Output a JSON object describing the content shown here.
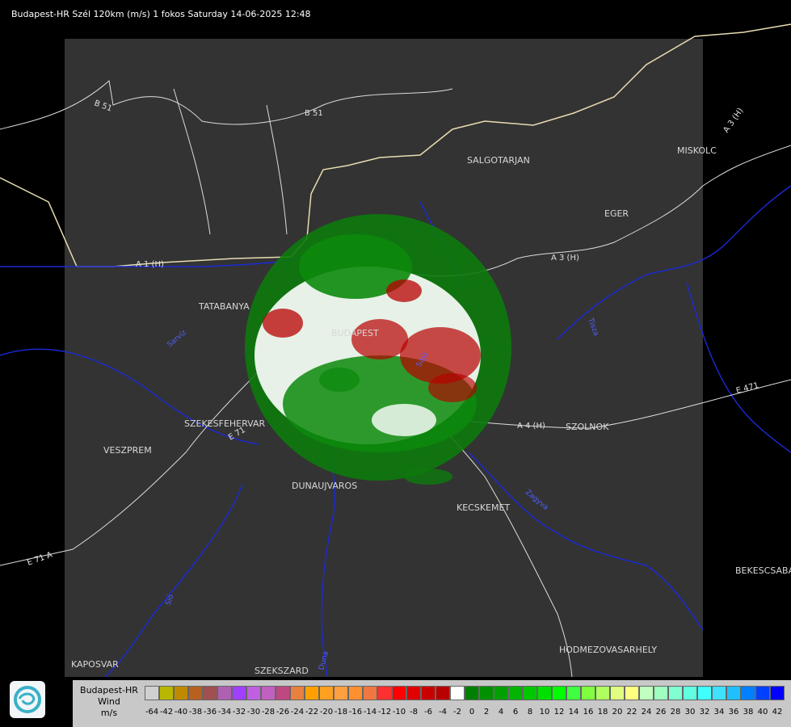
{
  "title": "Budapest-HR Szél 120km (m/s) 1 fokos Saturday 14-06-2025 12:48",
  "cities": [
    {
      "name": "SALGOTARJAN"
    },
    {
      "name": "MISKOLC"
    },
    {
      "name": "EGER"
    },
    {
      "name": "TATABANYA"
    },
    {
      "name": "BUDAPEST"
    },
    {
      "name": "SZEKESFEHERVAR"
    },
    {
      "name": "VESZPREM"
    },
    {
      "name": "DUNAUJVAROS"
    },
    {
      "name": "KECSKEMET"
    },
    {
      "name": "SZOLNOK"
    },
    {
      "name": "BEKESCSABA"
    },
    {
      "name": "HODMEZOVASARHELY"
    },
    {
      "name": "KAPOSVAR"
    },
    {
      "name": "SZEKSZARD"
    }
  ],
  "roads": [
    "B 51",
    "B 51",
    "A 1 (H)",
    "A 3 (H)",
    "A 3 (H)",
    "E 71",
    "A 4 (H)",
    "E 471",
    "E 71 A"
  ],
  "rivers": [
    "Tisza",
    "Duna",
    "Sarvíz",
    "Sió",
    "Zagyva",
    "Sajó"
  ],
  "legend": {
    "site": "Budapest-HR",
    "quantity": "Wind",
    "unit": "m/s",
    "ticks": [
      "-64",
      "-42",
      "-40",
      "-38",
      "-36",
      "-34",
      "-32",
      "-30",
      "-28",
      "-26",
      "-24",
      "-22",
      "-20",
      "-18",
      "-16",
      "-14",
      "-12",
      "-10",
      "-8",
      "-6",
      "-4",
      "-2",
      "0",
      "2",
      "4",
      "6",
      "8",
      "10",
      "12",
      "14",
      "16",
      "18",
      "20",
      "22",
      "24",
      "26",
      "28",
      "30",
      "32",
      "34",
      "36",
      "38",
      "40",
      "42"
    ],
    "colors": [
      "#d0d0d0",
      "#b8b800",
      "#c08a00",
      "#b86020",
      "#a05050",
      "#b060b0",
      "#a040ff",
      "#c060e0",
      "#c060c0",
      "#c04880",
      "#e88040",
      "#ffa000",
      "#ffa020",
      "#ffa040",
      "#ff9030",
      "#f07840",
      "#ff3030",
      "#ff0000",
      "#e00000",
      "#c80000",
      "#b80000",
      "#ffffff",
      "#008000",
      "#009000",
      "#00a000",
      "#00b400",
      "#00c800",
      "#00e000",
      "#00ff00",
      "#40ff40",
      "#80ff40",
      "#b0ff60",
      "#e0ff80",
      "#ffff80",
      "#c0ffc0",
      "#a0ffc0",
      "#80ffd0",
      "#60ffe0",
      "#40ffff",
      "#40e0ff",
      "#20c0ff",
      "#0080ff",
      "#0040ff",
      "#0000ff"
    ]
  }
}
